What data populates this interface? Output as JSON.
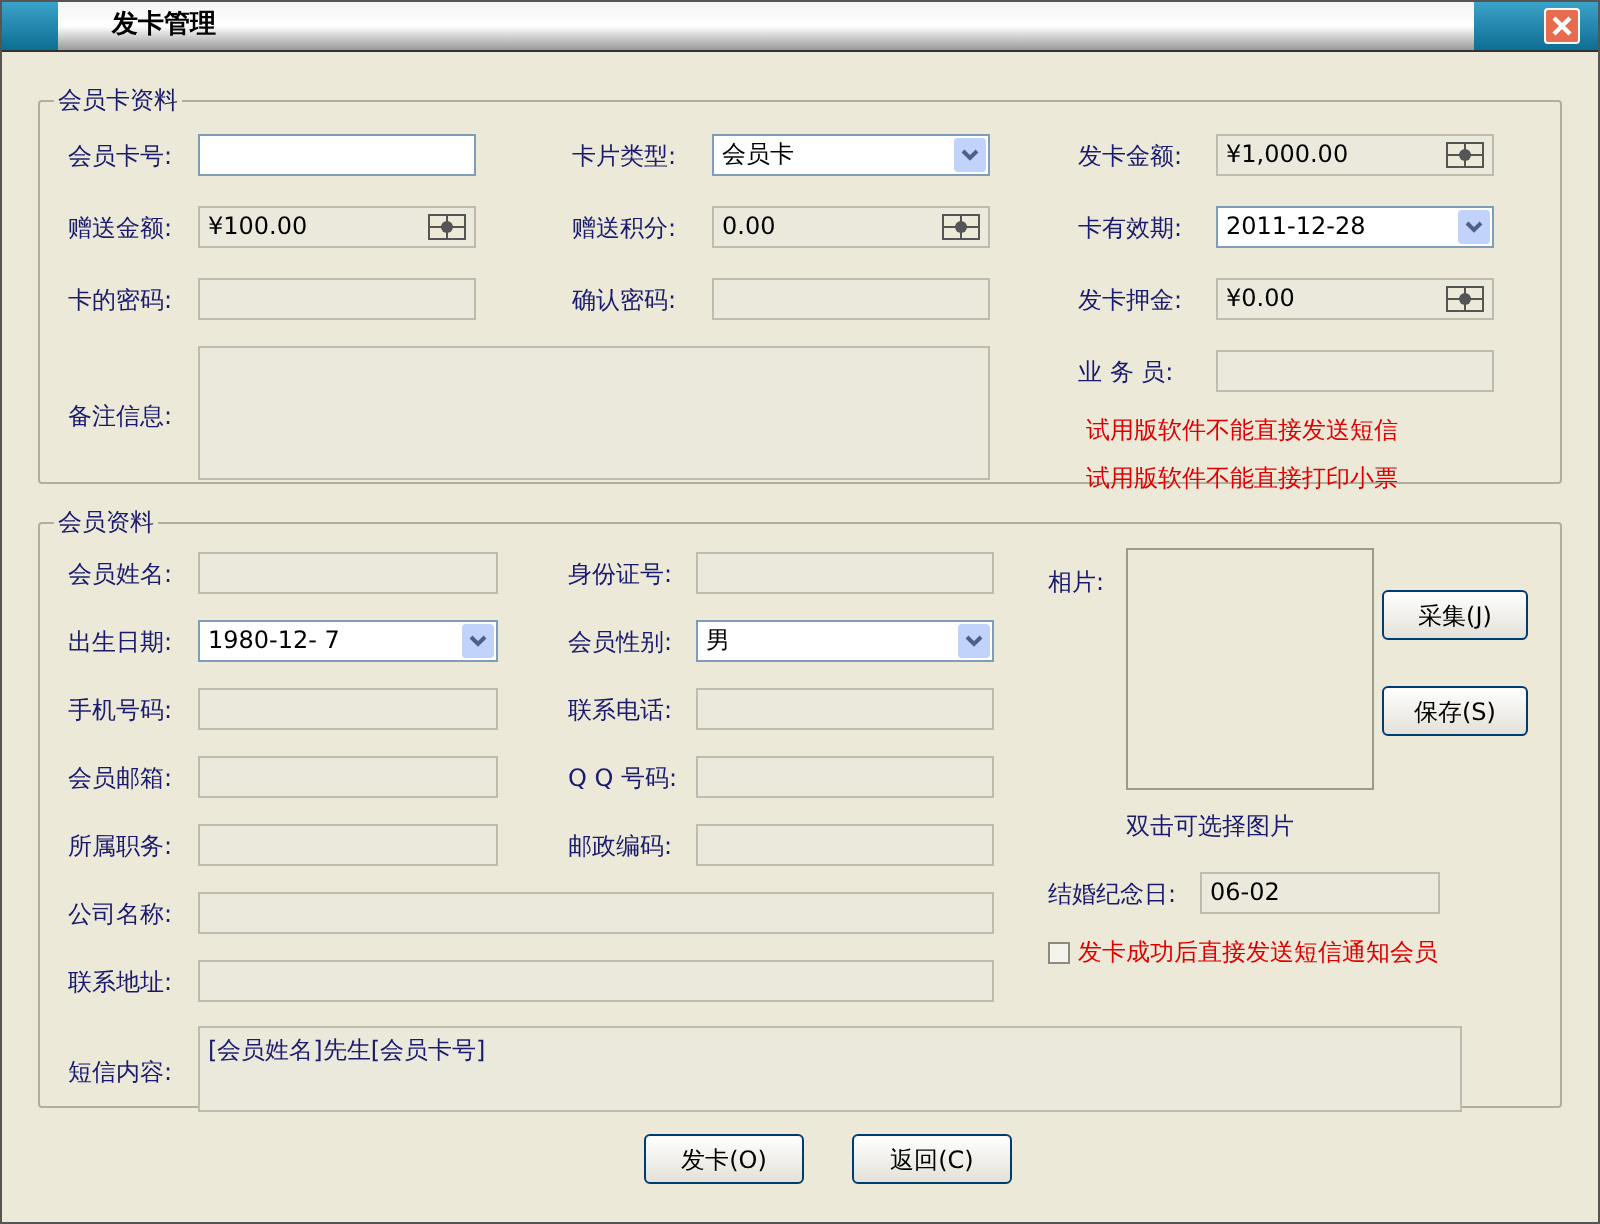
{
  "window": {
    "title": "发卡管理"
  },
  "card_group": {
    "title": "会员卡资料",
    "fields": [
      {
        "label": "会员卡号:",
        "kind": "text",
        "disabled": false
      },
      {
        "label": "卡片类型:",
        "kind": "combo",
        "value": "会员卡",
        "disabled": false
      },
      {
        "label": "发卡金额:",
        "kind": "spin",
        "value": "¥1,000.00",
        "disabled": true
      },
      {
        "label": "赠送金额:",
        "kind": "spin",
        "value": "¥100.00",
        "disabled": true
      },
      {
        "label": "赠送积分:",
        "kind": "spin",
        "value": "0.00",
        "disabled": true
      },
      {
        "label": "卡有效期:",
        "kind": "combo",
        "value": "2011-12-28",
        "disabled": false
      },
      {
        "label": "卡的密码:",
        "kind": "text",
        "disabled": true
      },
      {
        "label": "确认密码:",
        "kind": "text",
        "disabled": true
      },
      {
        "label": "发卡押金:",
        "kind": "spin",
        "value": "¥0.00",
        "disabled": true
      },
      {
        "label": "业 务 员:",
        "kind": "text",
        "disabled": true
      },
      {
        "label": "备注信息:",
        "kind": "memo",
        "disabled": true
      }
    ],
    "notices": [
      "试用版软件不能直接发送短信",
      "试用版软件不能直接打印小票"
    ]
  },
  "member_group": {
    "title": "会员资料",
    "fields": [
      {
        "label": "会员姓名:",
        "kind": "text",
        "disabled": true
      },
      {
        "label": "身份证号:",
        "kind": "text",
        "disabled": true
      },
      {
        "label": "出生日期:",
        "kind": "combo",
        "value": "1980-12- 7",
        "disabled": false
      },
      {
        "label": "会员性别:",
        "kind": "combo",
        "value": "男",
        "disabled": false
      },
      {
        "label": "手机号码:",
        "kind": "text",
        "disabled": true
      },
      {
        "label": "联系电话:",
        "kind": "text",
        "disabled": true
      },
      {
        "label": "会员邮箱:",
        "kind": "text",
        "disabled": true
      },
      {
        "label": "Q Q 号码:",
        "kind": "text",
        "disabled": true
      },
      {
        "label": "所属职务:",
        "kind": "text",
        "disabled": true
      },
      {
        "label": "邮政编码:",
        "kind": "text",
        "disabled": true
      }
    ],
    "wide_fields": [
      {
        "label": "公司名称:",
        "kind": "text",
        "disabled": true
      },
      {
        "label": "联系地址:",
        "kind": "text",
        "disabled": true
      }
    ],
    "photo": {
      "label": "相片:",
      "caption": "双击可选择图片",
      "buttons": [
        "采集(J)",
        "保存(S)"
      ]
    },
    "anniversary": {
      "label": "结婚纪念日:",
      "kind": "text",
      "value": "06-02",
      "disabled": true
    },
    "sms_checkbox": {
      "label": "发卡成功后直接发送短信通知会员",
      "checked": false
    },
    "sms": {
      "label": "短信内容:",
      "kind": "memo",
      "value": "[会员姓名]先生[会员卡号]",
      "disabled": true
    }
  },
  "buttons": [
    "发卡(O)",
    "返回(C)"
  ]
}
